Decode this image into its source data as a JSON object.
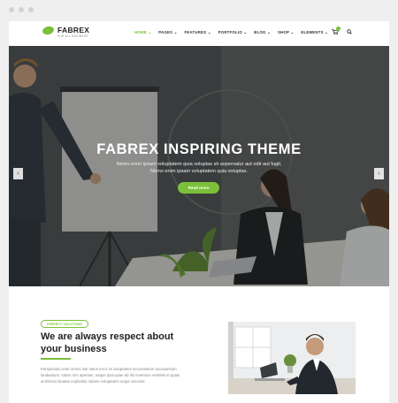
{
  "brand": {
    "name": "FABREX",
    "tagline": "FOR ALL BUSINESS",
    "accent": "#7bbf3a"
  },
  "nav": {
    "items": [
      {
        "label": "HOME ⌄",
        "active": true
      },
      {
        "label": "PAGES ⌄",
        "active": false
      },
      {
        "label": "FEATURES ⌄",
        "active": false
      },
      {
        "label": "PORTFOLIO ⌄",
        "active": false
      },
      {
        "label": "BLOG ⌄",
        "active": false
      },
      {
        "label": "SHOP ⌄",
        "active": false
      },
      {
        "label": "ELEMENTS ⌄",
        "active": false
      }
    ],
    "cart_icon": "cart-icon",
    "search_icon": "search-icon"
  },
  "hero": {
    "title": "FABREX INSPIRING THEME",
    "text": "Nemo enim ipsam voluptatem quia voluptas sit aspernatur aut odit aut fugit. Nemo enim ipsam voluptatem quia voluptas.",
    "button": "Read more",
    "prev": "‹",
    "next": "›"
  },
  "about": {
    "tag": "PERFECT SOLUTIONS",
    "title": "We are always respect about your business",
    "text": "Perspiciatis unde omnis iste natus error sit voluptatem accusantium accusantium laudantium, totam rem aperiam, eaque ipsa quae ab illo inventore veritatis et quasi architecto beatae explicabo ratione voluptatem sequi nesciunt."
  }
}
